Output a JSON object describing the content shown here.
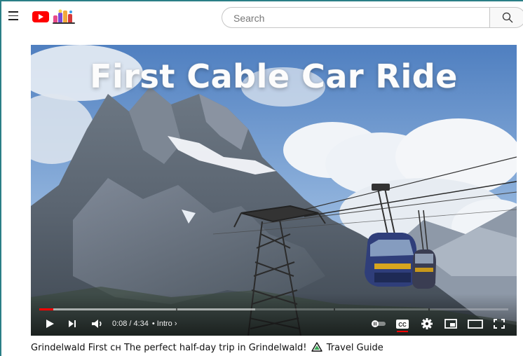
{
  "search": {
    "placeholder": "Search"
  },
  "video": {
    "overlay_title": "First Cable Car Ride",
    "title_before": "Grindelwald First ᴄʜ The perfect half-day trip in Grindelwald!",
    "title_after": "Travel Guide"
  },
  "player": {
    "current_time": "0:08",
    "time_separator": "/",
    "duration": "4:34",
    "chapter_separator": "•",
    "chapter": "Intro ›",
    "progress_played_fraction": 0.03,
    "progress_buffered_fraction": 0.46
  },
  "icons": {
    "menu": "hamburger-menu-icon",
    "logo": "youtube-logo-icon",
    "doodle": "doodle-icon",
    "search": "search-icon",
    "play": "play-icon",
    "next": "next-icon",
    "volume": "volume-icon",
    "autoplay": "autoplay-toggle-icon",
    "captions": "captions-icon",
    "settings": "settings-gear-icon",
    "miniplayer": "miniplayer-icon",
    "theater": "theater-mode-icon",
    "fullscreen": "fullscreen-icon",
    "warning": "warning-triangle-icon"
  },
  "colors": {
    "accent_red": "#ff0000",
    "frame": "#2a7f86",
    "title_text": "#0f0f0f"
  }
}
